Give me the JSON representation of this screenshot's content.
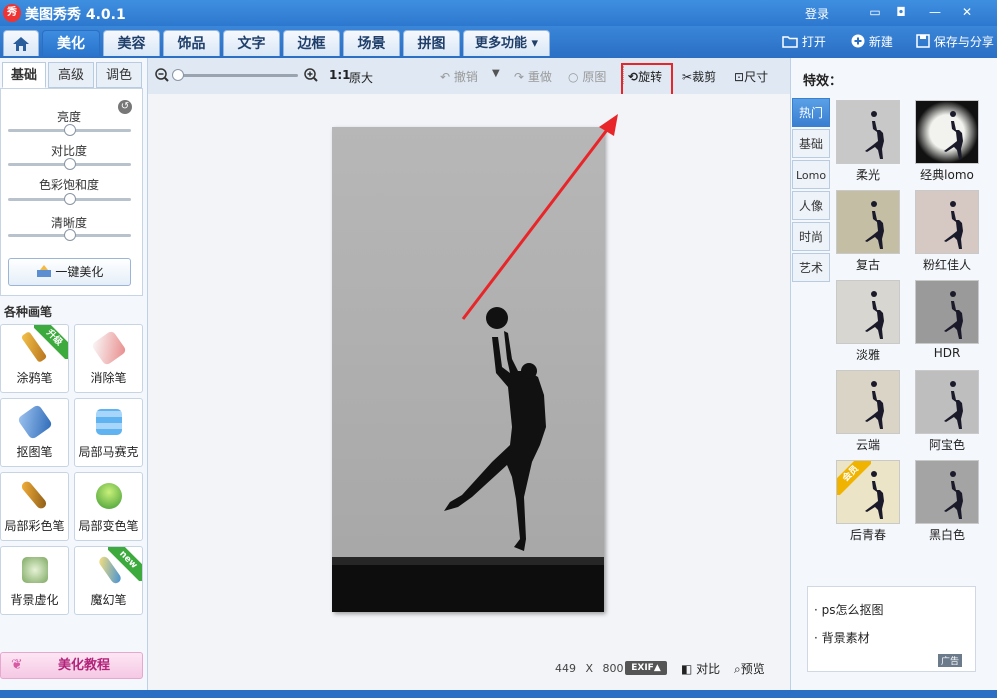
{
  "app": {
    "title": "美图秀秀 4.0.1",
    "logo_text": "秀",
    "login": "登录"
  },
  "window_buttons": [
    "▭",
    "◘",
    "—",
    "✕"
  ],
  "tabs": [
    {
      "label": "美化",
      "active": true
    },
    {
      "label": "美容"
    },
    {
      "label": "饰品"
    },
    {
      "label": "文字"
    },
    {
      "label": "边框"
    },
    {
      "label": "场景"
    },
    {
      "label": "拼图"
    },
    {
      "label": "更多功能 ▾"
    }
  ],
  "top_actions": {
    "open": "打开",
    "new": "新建",
    "save_share": "保存与分享"
  },
  "left": {
    "subtabs": [
      "基础",
      "高级",
      "调色"
    ],
    "adjust": [
      {
        "label": "亮度",
        "value": 0.5
      },
      {
        "label": "对比度",
        "value": 0.5
      },
      {
        "label": "色彩饱和度",
        "value": 0.5
      },
      {
        "label": "清晰度",
        "value": 0.5
      }
    ],
    "onekey": "一键美化",
    "brush_title": "各种画笔",
    "brushes": [
      {
        "label": "涂鸦笔",
        "badge": "升级"
      },
      {
        "label": "消除笔"
      },
      {
        "label": "抠图笔"
      },
      {
        "label": "局部马赛克"
      },
      {
        "label": "局部彩色笔"
      },
      {
        "label": "局部变色笔"
      },
      {
        "label": "背景虚化"
      },
      {
        "label": "魔幻笔",
        "badge": "new"
      }
    ],
    "tutorial": "美化教程"
  },
  "toolbar": {
    "one_to_one": "1:1",
    "original_size": "原大",
    "undo": "撤销",
    "redo": "重做",
    "original": "原图",
    "rotate": "旋转",
    "crop": "裁剪",
    "size": "尺寸"
  },
  "status": {
    "width": "449",
    "times": "X",
    "height": "800",
    "exif": "EXIF▲",
    "compare": "对比",
    "preview": "预览"
  },
  "right": {
    "title": "特效：",
    "vtabs": [
      {
        "label": "热门",
        "active": true
      },
      {
        "label": "基础"
      },
      {
        "label": "Lomo"
      },
      {
        "label": "人像"
      },
      {
        "label": "时尚"
      },
      {
        "label": "艺术"
      }
    ],
    "effects": [
      {
        "label": "柔光",
        "bg": "#c8c8c8"
      },
      {
        "label": "经典lomo",
        "bg": "#f2f2ee"
      },
      {
        "label": "复古",
        "bg": "#c4bfa4"
      },
      {
        "label": "粉红佳人",
        "bg": "#d6c9c4"
      },
      {
        "label": "淡雅",
        "bg": "#d8d6d0"
      },
      {
        "label": "HDR",
        "bg": "#9a9a9a"
      },
      {
        "label": "云端",
        "bg": "#d9d4c6"
      },
      {
        "label": "阿宝色",
        "bg": "#bebebe"
      },
      {
        "label": "后青春",
        "bg": "#ece4c6",
        "badge": "会员"
      },
      {
        "label": "黑白色",
        "bg": "#a4a4a4"
      }
    ],
    "ad_links": [
      "ps怎么抠图",
      "背景素材"
    ],
    "ad_label": "广告"
  },
  "colors": {
    "accent": "#2a6fc4",
    "highlight_box": "#e8262a",
    "arrow": "#e8262a"
  }
}
